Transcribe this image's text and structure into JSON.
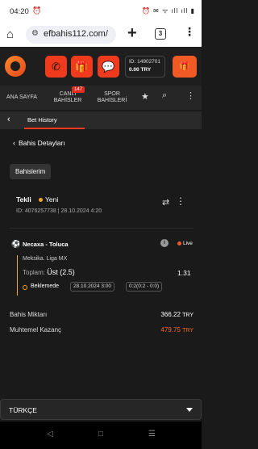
{
  "status_bar": {
    "time": "04:20",
    "right_icons": "⏰ ✉ ᯤ ıll ıll ▮"
  },
  "browser": {
    "url": "efbahis112.com/",
    "tab_count": "3"
  },
  "header": {
    "user_id": "ID: 14902701",
    "balance": "0.00 TRY",
    "gift_label": "🎁"
  },
  "nav": {
    "items": [
      "ANA SAYFA",
      "CANLI BAHİSLER",
      "SPOR BAHİSLERİ"
    ],
    "badge": "147"
  },
  "bet_history": {
    "title": "Bet History"
  },
  "detail": {
    "title": "Bahis Detayları",
    "my_bets_label": "Bahislerim"
  },
  "bet": {
    "type": "Tekli",
    "status": "Yeni",
    "id_line": "ID: 4076257738 | 28.10.2024 4:20"
  },
  "match": {
    "teams": "Necaxa - Toluca",
    "live_label": "Live",
    "league": "Meksika. Liga MX",
    "market_label": "Toplam:",
    "selection": "Üst (2.5)",
    "odds": "1.31",
    "state": "Beklemede",
    "date": "28.10.2024 3:00",
    "score": "0:2(0:2 - 0:0)"
  },
  "summary": {
    "stake_label": "Bahis Miktarı",
    "stake_amount": "366.22",
    "stake_currency": "TRY",
    "win_label": "Muhtemel Kazanç",
    "win_amount": "479.75",
    "win_currency": "TRY"
  },
  "language": {
    "selected": "TÜRKÇE"
  },
  "colors": {
    "accent": "#ef3a1d",
    "pending": "#f5a623",
    "win": "#f26b2a"
  }
}
